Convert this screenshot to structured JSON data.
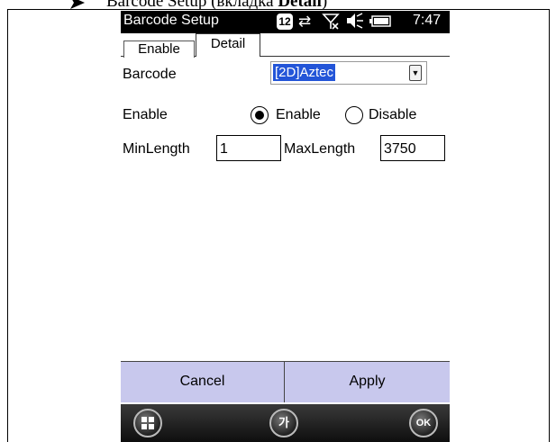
{
  "doc": {
    "caption_prefix": "Barcode Setup (вкладка ",
    "caption_bold": "Detail",
    "caption_suffix": ")"
  },
  "statusbar": {
    "title": "Barcode Setup",
    "badge": "12",
    "time": "7:47"
  },
  "tabs": [
    {
      "label": "Enable"
    },
    {
      "label": "Detail"
    }
  ],
  "form": {
    "barcode_label": "Barcode",
    "barcode_value": "[2D]Aztec",
    "enable_label": "Enable",
    "enable_option": "Enable",
    "disable_option": "Disable",
    "selected": "Enable",
    "minlength_label": "MinLength",
    "minlength_value": "1",
    "maxlength_label": "MaxLength",
    "maxlength_value": "3750"
  },
  "buttons": {
    "cancel": "Cancel",
    "apply": "Apply"
  },
  "softkeys": {
    "center": "가",
    "right": "OK"
  }
}
